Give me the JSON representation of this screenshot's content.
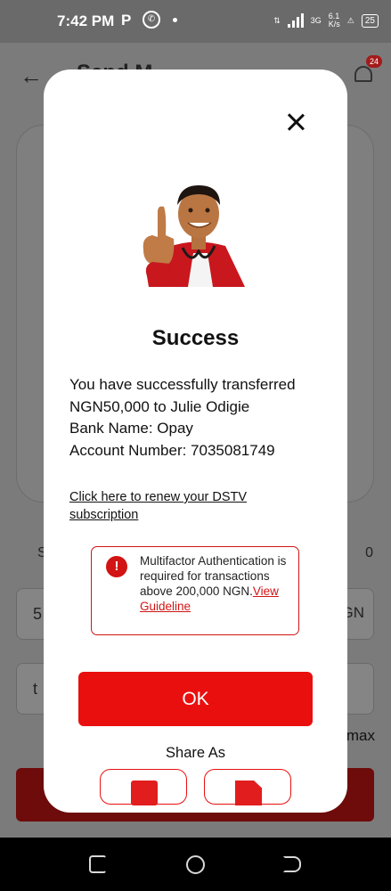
{
  "status_bar": {
    "time": "7:42 PM",
    "p_icon": "P",
    "network": "3G",
    "speed": "6.1\nK/s",
    "battery": "25"
  },
  "background": {
    "title": "Send M",
    "notification_count": "24",
    "label_left": "S",
    "label_right": "0",
    "amount_field": "5",
    "currency": "GN",
    "note_field": "t",
    "max_label": "max"
  },
  "modal": {
    "title": "Success",
    "message_line1": "You have successfully transferred NGN50,000 to Julie Odigie",
    "bank_name": "Bank Name: Opay",
    "account_number": "Account Number: 7035081749",
    "dstv_link": "Click here to renew your DSTV subscription",
    "notice_text": "Multifactor Authentication is required for transactions above 200,000 NGN.",
    "notice_link": "View Guideline",
    "ok_label": "OK",
    "share_label": "Share As"
  },
  "colors": {
    "accent": "#ea0f0f",
    "notice_border": "#d11414"
  }
}
